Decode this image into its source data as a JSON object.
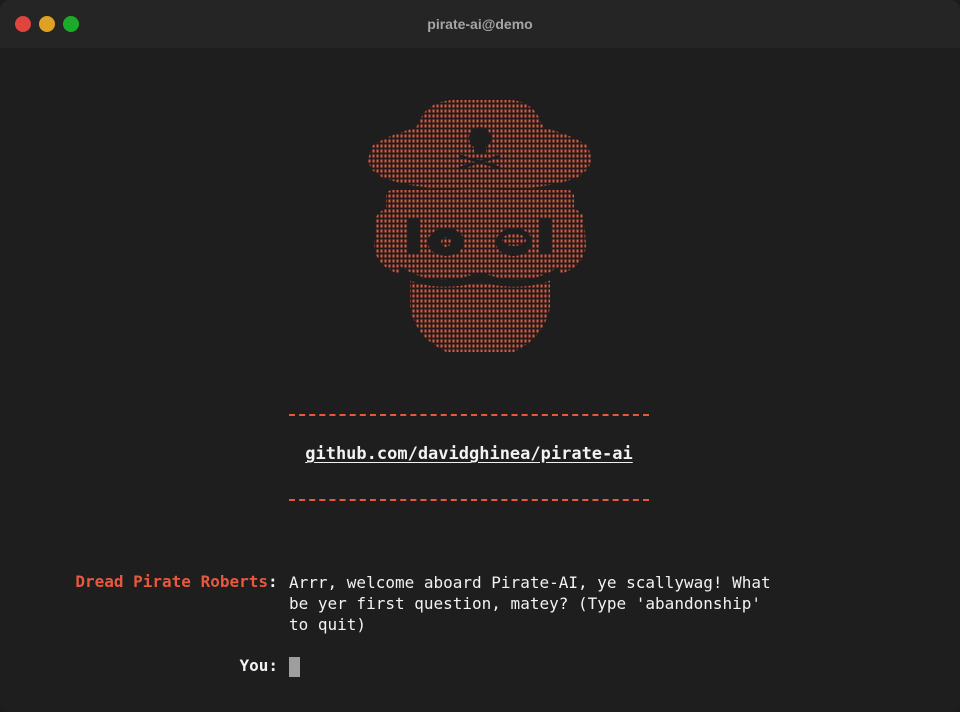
{
  "window": {
    "title": "pirate-ai@demo",
    "traffic_lights": {
      "close_color": "#e0443e",
      "minimize_color": "#dea123",
      "zoom_color": "#1aab29"
    }
  },
  "terminal": {
    "accent_color": "#e8583f",
    "text_color": "#f2f2f2",
    "logo_icon": "pirate-skull-ascii-art-icon",
    "link": "github.com/davidghinea/pirate-ai",
    "speaker": "Dread Pirate Roberts",
    "speaker_suffix": ":",
    "message_lines": [
      "Arrr, welcome aboard Pirate-AI, ye scallywag! What",
      "be yer first question, matey? (Type 'abandonship'",
      "to quit)"
    ],
    "prompt_label": "You:",
    "input_value": ""
  }
}
